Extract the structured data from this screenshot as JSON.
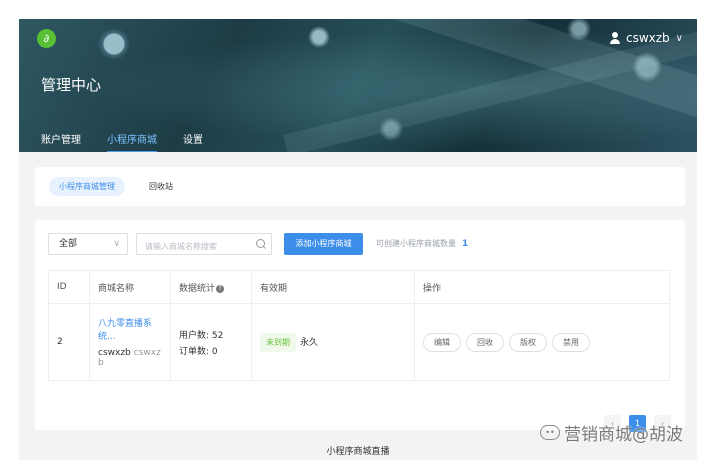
{
  "header": {
    "title": "管理中心",
    "username": "cswxzb",
    "tabs": [
      {
        "label": "账户管理",
        "active": false
      },
      {
        "label": "小程序商城",
        "active": true
      },
      {
        "label": "设置",
        "active": false
      }
    ]
  },
  "subnav": {
    "active_label": "小程序商城管理",
    "recycle_label": "回收站"
  },
  "toolbar": {
    "filter_value": "全部",
    "search_placeholder": "请输入商城名称搜索",
    "add_button": "添加小程序商城",
    "quota_label": "可创建小程序商城数量",
    "quota_value": "1"
  },
  "table": {
    "columns": [
      "ID",
      "商城名称",
      "数据统计",
      "有效期",
      "操作"
    ],
    "rows": [
      {
        "id": "2",
        "store_name": "八九零直播系统...",
        "owner": "cswxzb",
        "owner_sub": "cswxz",
        "owner_sub2": "b",
        "users": "用户数: 52",
        "orders": "订单数: 0",
        "status": "未到期",
        "validity": "永久",
        "actions": [
          "编辑",
          "回收",
          "版权",
          "禁用"
        ]
      }
    ]
  },
  "pagination": {
    "prev": "‹",
    "current": "1",
    "next": "›"
  },
  "footer": {
    "text": "小程序商城直播"
  },
  "watermark": {
    "text": "营销商城@胡波"
  },
  "colors": {
    "accent": "#3d8eea",
    "status_green": "#67c23a",
    "logo_green": "#59c035"
  }
}
